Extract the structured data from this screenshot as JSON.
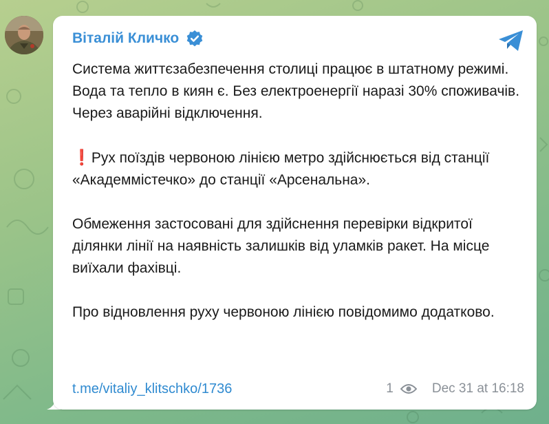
{
  "post": {
    "sender": "Віталій Кличко",
    "paragraphs": {
      "p1": "Система життєзабезпечення столиці працює в штатному режимі. Вода та тепло в киян є. Без електроенергії наразі 30% споживачів. Через аварійні відключення.",
      "p2": "Рух поїздів червоною лінією метро здійснюється від станції «Академмістечко» до станції «Арсенальна».",
      "p3": "Обмеження застосовані для здійснення перевірки відкритої ділянки лінії на наявність залишків від уламків ракет. На місце виїхали фахівці.",
      "p4": "Про відновлення руху червоною лінією повідомимо додатково."
    },
    "p2_prefix_glyph": "❗",
    "link": "t.me/vitaliy_klitschko/1736",
    "views": "1",
    "timestamp": "Dec 31 at 16:18"
  },
  "icons": {
    "verified": "verified-badge-icon",
    "share": "telegram-share-icon",
    "views": "eye-icon"
  },
  "colors": {
    "accent": "#3a8fd6",
    "link": "#2f8ad0",
    "meta": "#8a9097",
    "alert": "#e0243a",
    "bubble": "#ffffff"
  }
}
